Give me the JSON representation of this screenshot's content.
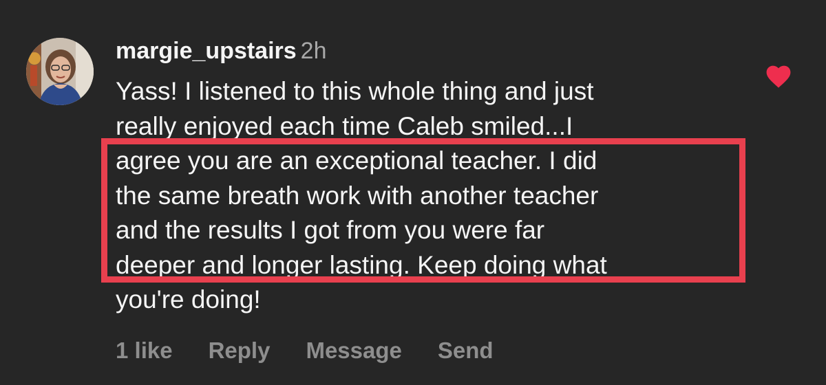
{
  "comment": {
    "username": "margie_upstairs",
    "timestamp": "2h",
    "lines": [
      "Yass! I listened to this whole thing and just",
      "really enjoyed each time Caleb smiled...I",
      "agree you are an exceptional teacher. I did",
      "the same breath work with another teacher",
      "and the results I got from you were far",
      "deeper and longer lasting. Keep doing what",
      "you're doing!"
    ],
    "liked_icon": "heart-filled-icon",
    "highlight_color": "#e8404e"
  },
  "actions": {
    "likes": "1 like",
    "reply": "Reply",
    "message": "Message",
    "send": "Send"
  }
}
